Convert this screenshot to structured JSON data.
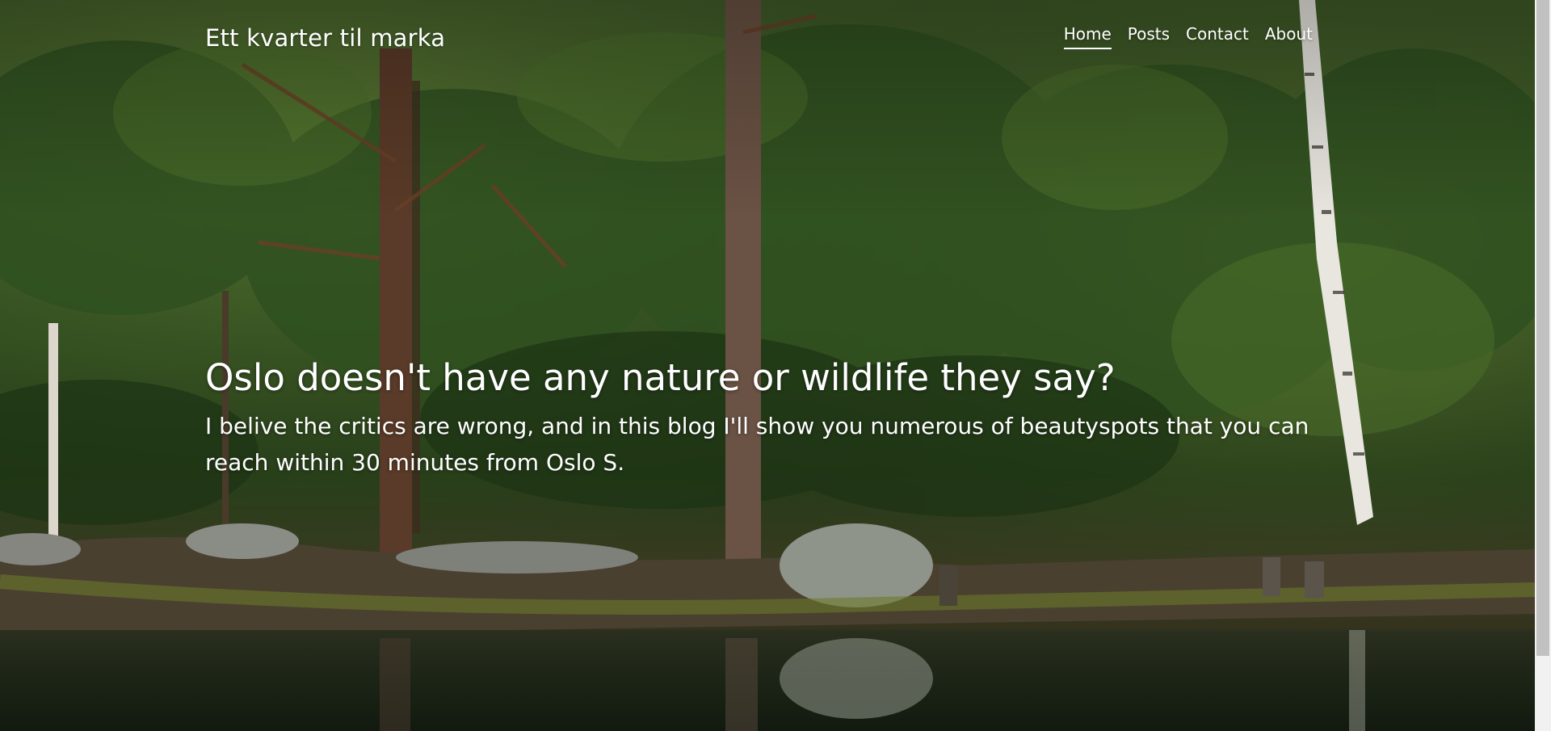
{
  "site": {
    "title": "Ett kvarter til marka"
  },
  "nav": {
    "items": [
      {
        "label": "Home",
        "active": true
      },
      {
        "label": "Posts",
        "active": false
      },
      {
        "label": "Contact",
        "active": false
      },
      {
        "label": "About",
        "active": false
      }
    ]
  },
  "hero": {
    "heading": "Oslo doesn't have any nature or wildlife they say?",
    "subtext": "I belive the critics are wrong, and in this blog I'll show you numerous of beautyspots that you can reach within 30 minutes from Oslo S.",
    "background_image": "forest-lake-photo"
  },
  "colors": {
    "text": "#ffffff",
    "scrollbar_track": "#f1f1f1",
    "scrollbar_thumb": "#c1c1c1"
  }
}
